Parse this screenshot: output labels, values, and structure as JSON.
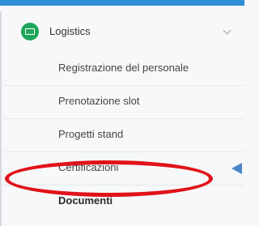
{
  "menu": {
    "group": {
      "label": "Logistics",
      "icon": "monitor-icon",
      "icon_color": "#1fa65b",
      "expanded": true
    },
    "items": [
      {
        "label": "Registrazione del personale"
      },
      {
        "label": "Prenotazione slot"
      },
      {
        "label": "Progetti stand"
      },
      {
        "label": "Certificazioni",
        "highlighted": true
      },
      {
        "label": "Documenti"
      }
    ]
  },
  "annotation": {
    "highlight_color": "#e0131a",
    "pointer_color": "#4b86c6",
    "target": "Certificazioni"
  },
  "accent": "#2e8fd6"
}
